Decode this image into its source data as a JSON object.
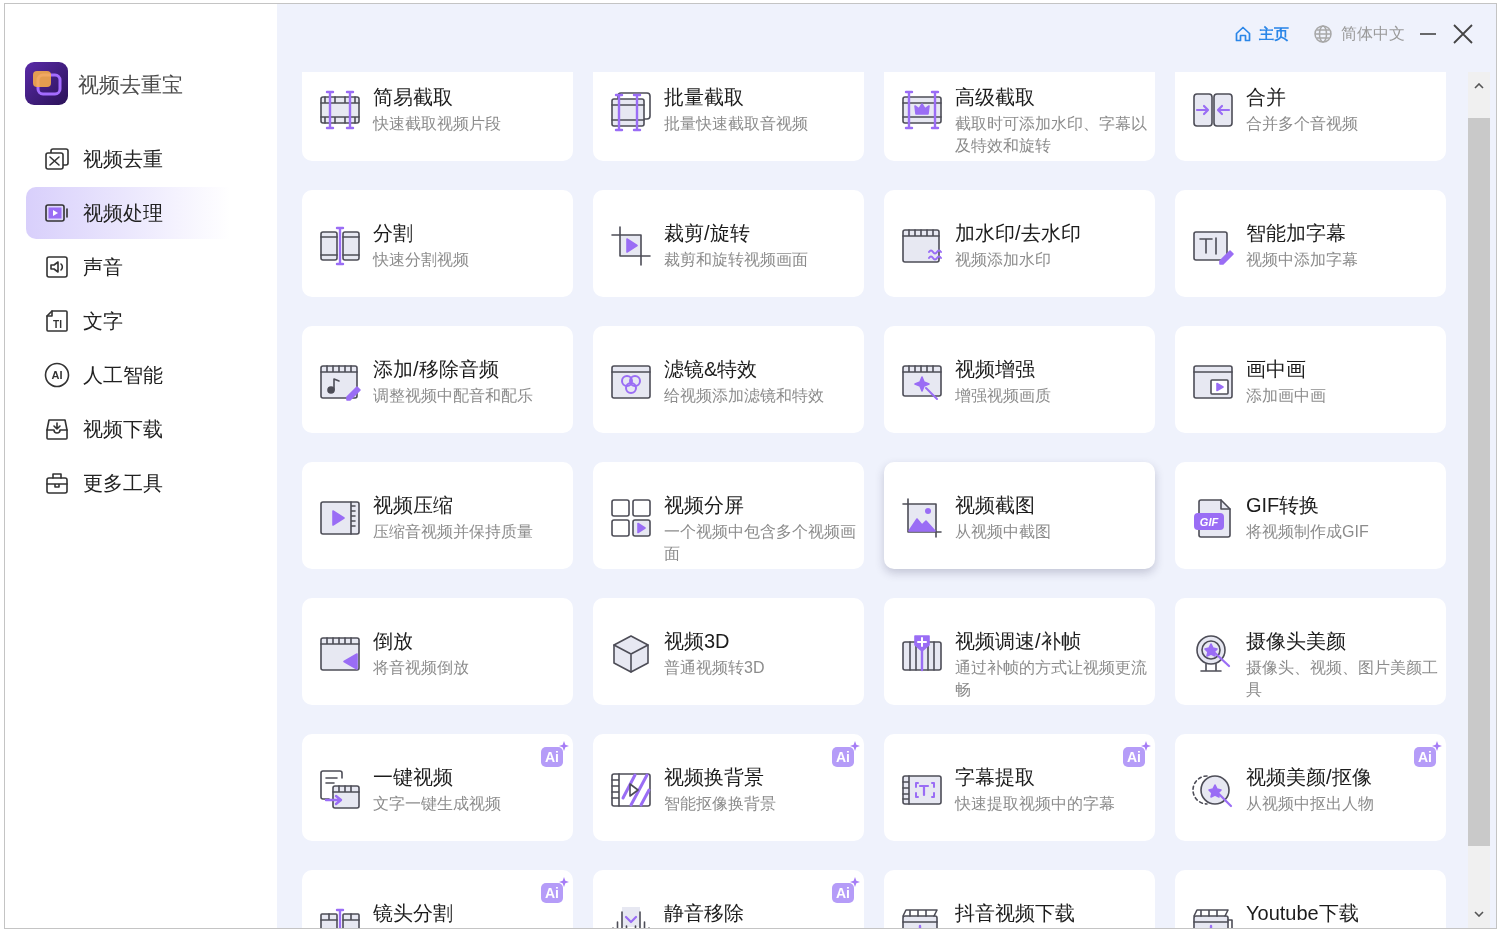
{
  "app": {
    "name": "视频去重宝"
  },
  "sidebar": {
    "items": [
      {
        "label": "视频去重",
        "selected": false
      },
      {
        "label": "视频处理",
        "selected": true
      },
      {
        "label": "声音",
        "selected": false
      },
      {
        "label": "文字",
        "selected": false,
        "icon_text": "TI"
      },
      {
        "label": "人工智能",
        "selected": false,
        "icon_text": "AI"
      },
      {
        "label": "视频下载",
        "selected": false
      },
      {
        "label": "更多工具",
        "selected": false
      }
    ]
  },
  "header": {
    "home": "主页",
    "language": "简体中文"
  },
  "tools": [
    {
      "title": "简易截取",
      "subtitle": "快速截取视频片段",
      "hovered": false
    },
    {
      "title": "批量截取",
      "subtitle": "批量快速截取音视频",
      "hovered": false
    },
    {
      "title": "高级截取",
      "subtitle": "截取时可添加水印、字幕以及特效和旋转",
      "hovered": false
    },
    {
      "title": "合并",
      "subtitle": "合并多个音视频",
      "hovered": false
    },
    {
      "title": "分割",
      "subtitle": "快速分割视频",
      "hovered": false
    },
    {
      "title": "裁剪/旋转",
      "subtitle": "裁剪和旋转视频画面",
      "hovered": false
    },
    {
      "title": "加水印/去水印",
      "subtitle": "视频添加水印",
      "hovered": false
    },
    {
      "title": "智能加字幕",
      "subtitle": "视频中添加字幕",
      "hovered": false
    },
    {
      "title": "添加/移除音频",
      "subtitle": "调整视频中配音和配乐",
      "hovered": false
    },
    {
      "title": "滤镜&特效",
      "subtitle": "给视频添加滤镜和特效",
      "hovered": false
    },
    {
      "title": "视频增强",
      "subtitle": "增强视频画质",
      "hovered": false
    },
    {
      "title": "画中画",
      "subtitle": "添加画中画",
      "hovered": false
    },
    {
      "title": "视频压缩",
      "subtitle": "压缩音视频并保持质量",
      "hovered": false
    },
    {
      "title": "视频分屏",
      "subtitle": "一个视频中包含多个视频画面",
      "hovered": false
    },
    {
      "title": "视频截图",
      "subtitle": "从视频中截图",
      "hovered": true
    },
    {
      "title": "GIF转换",
      "subtitle": "将视频制作成GIF",
      "hovered": false,
      "icon_text": "GIF"
    },
    {
      "title": "倒放",
      "subtitle": "将音视频倒放",
      "hovered": false
    },
    {
      "title": "视频3D",
      "subtitle": "普通视频转3D",
      "hovered": false
    },
    {
      "title": "视频调速/补帧",
      "subtitle": "通过补帧的方式让视频更流畅",
      "hovered": false
    },
    {
      "title": "摄像头美颜",
      "subtitle": "摄像头、视频、图片美颜工具",
      "hovered": false
    },
    {
      "title": "一键视频",
      "subtitle": "文字一键生成视频",
      "hovered": false,
      "badge": "Ai"
    },
    {
      "title": "视频换背景",
      "subtitle": "智能抠像换背景",
      "hovered": false,
      "badge": "Ai"
    },
    {
      "title": "字幕提取",
      "subtitle": "快速提取视频中的字幕",
      "hovered": false,
      "badge": "Ai"
    },
    {
      "title": "视频美颜/抠像",
      "subtitle": "从视频中抠出人物",
      "hovered": false,
      "badge": "Ai"
    },
    {
      "title": "镜头分割",
      "hovered": false,
      "badge": "Ai"
    },
    {
      "title": "静音移除",
      "hovered": false,
      "badge": "Ai"
    },
    {
      "title": "抖音视频下载",
      "hovered": false
    },
    {
      "title": "Youtube下载",
      "hovered": false
    }
  ]
}
